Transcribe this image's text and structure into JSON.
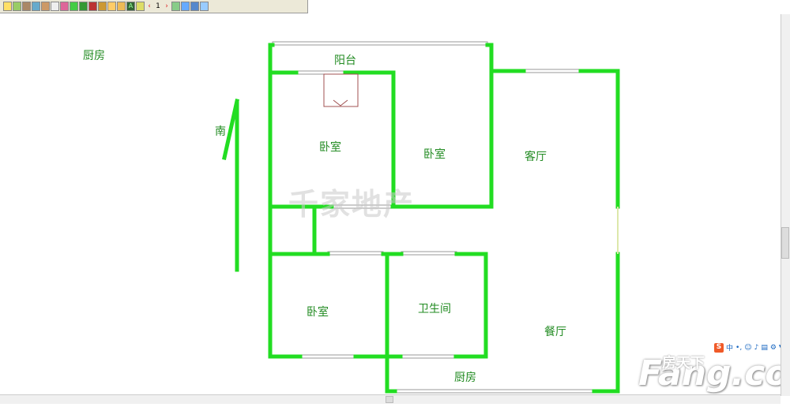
{
  "toolbar": {
    "icons": [
      "pointer-icon",
      "wall-icon",
      "door-icon",
      "window-icon",
      "cabinet-icon",
      "toilet-icon",
      "chair-icon",
      "sofa-icon",
      "tree-icon",
      "fireplace-icon",
      "paint-icon",
      "fill-icon",
      "stairs-icon",
      "text-icon",
      "pencil-icon",
      "prev-icon",
      "page-number",
      "next-icon",
      "grid-icon",
      "measure-icon",
      "camera-icon",
      "zoom-icon"
    ],
    "page": "1"
  },
  "rooms": {
    "kitchen_top": "厨房",
    "balcony": "阳台",
    "bedroom1": "卧室",
    "bedroom2": "卧室",
    "living": "客厅",
    "bedroom3": "卧室",
    "bathroom": "卫生间",
    "dining": "餐厅",
    "kitchen": "厨房"
  },
  "compass": "南",
  "watermark": "千家地产",
  "logo": {
    "cn": "房天下",
    "en": "Fang.com"
  },
  "colors": {
    "wall": "#22dd22",
    "label": "#228b22"
  }
}
